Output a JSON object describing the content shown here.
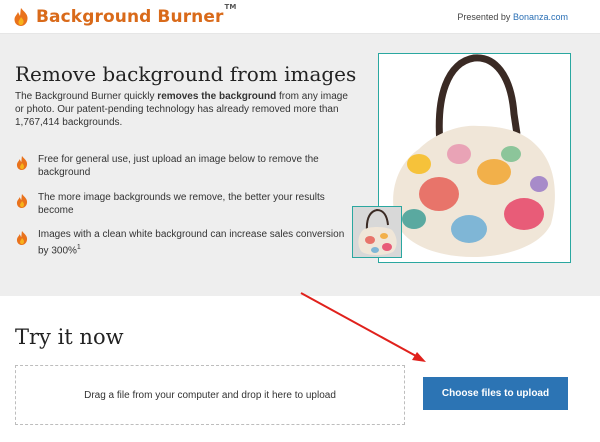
{
  "header": {
    "brand": "Background Burner",
    "brand_tm": "TM",
    "presented_prefix": "Presented by",
    "presented_link": "Bonanza.com"
  },
  "hero": {
    "title": "Remove background from images",
    "desc_part1": "The Background Burner quickly ",
    "desc_bold": "removes the background",
    "desc_part2": " from any image or photo. Our patent-pending technology has already removed more than 1,767,414 backgrounds.",
    "features": [
      {
        "text": "Free for general use, just upload an image below to remove the background"
      },
      {
        "text": "The more image backgrounds we remove, the better your results become"
      },
      {
        "text": "Images with a clean white background can increase sales conversion by 300%",
        "sup": "1"
      }
    ]
  },
  "upload": {
    "title": "Try it now",
    "drop_text": "Drag a file from your computer and drop it here to upload",
    "button_label": "Choose files to upload"
  },
  "colors": {
    "accent": "#d96a1a",
    "button": "#2c74b4",
    "frame": "#2aa7a0",
    "arrow": "#e0211c"
  },
  "icons": [
    "flame-icon",
    "handbag-image",
    "red-arrow"
  ]
}
